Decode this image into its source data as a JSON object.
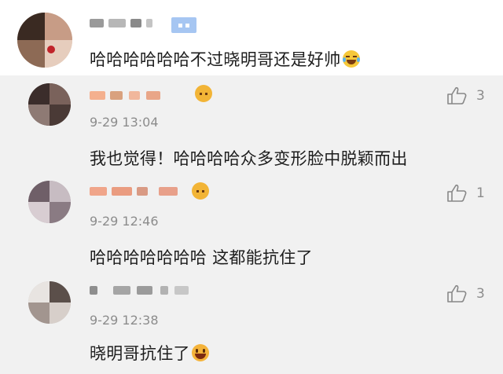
{
  "top_comment": {
    "text": "哈哈哈哈哈哈不过晓明哥还是好帅",
    "emoji_icon": "laughing-tears-emoji"
  },
  "replies": [
    {
      "text": "我也觉得！哈哈哈哈众多变形脸中脱颖而出",
      "time": "9-29 13:04",
      "likes": "3"
    },
    {
      "text": "哈哈哈哈哈哈哈 这都能抗住了",
      "time": "9-29 12:46",
      "likes": "1"
    },
    {
      "text": "晓明哥抗住了",
      "time": "9-29 12:38",
      "likes": "3",
      "emoji_icon": "grinning-emoji"
    }
  ],
  "colors": {
    "reply_bg": "#f1f1f1",
    "badge": "#a6c6f2",
    "meta": "#8c8c8c"
  },
  "icons": {
    "like": "thumbs-up-icon"
  }
}
